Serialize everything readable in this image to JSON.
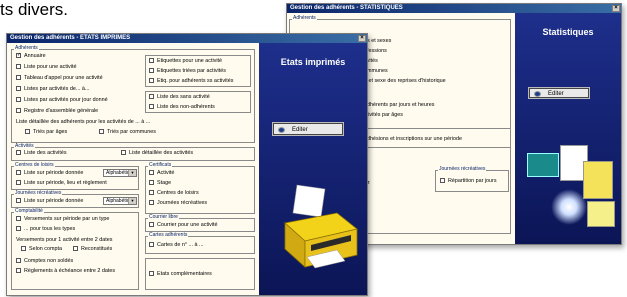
{
  "caption": "ts divers.",
  "stats_window": {
    "title": "Gestion des adhérents - STATISTIQUES",
    "group_label": "Adhérents",
    "rows": [
      "es et sexes",
      "ofessions",
      "tivités",
      "ommunes",
      "e et sexe des reprises d'historique",
      "adhérents par jours et heures",
      "ctivités par âges",
      "adhésions et inscriptions sur une période",
      "ez",
      "r"
    ],
    "journees_label": "Journées récréatives",
    "repetition_label": "Répartition par jours",
    "heading": "Statistiques",
    "edit_button": "Editer"
  },
  "main_window": {
    "title": "Gestion des adhérents - ETATS IMPRIMES",
    "heading": "Etats imprimés",
    "edit_button": "Editer",
    "adherents": {
      "label": "Adhérents",
      "left": [
        "Annuaire",
        "Liste pour une activité",
        "Tableau d'appel pour une activité",
        "Listes par activités de... à...",
        "Listes par activités pour jour donné",
        "Registre d'assemblée générale"
      ],
      "right": [
        "Etiquettes pour une activité",
        "Etiquettes triées par activités",
        "Etiq. pour adhérents ss activités"
      ],
      "right2": [
        "Liste des sans activité",
        "Liste des non-adhérents"
      ],
      "detail_text": "Liste détaillée des adhérents pour les activités de ... à ...",
      "sort1": "Triés par âges",
      "sort2": "Triés par communes"
    },
    "activites": {
      "label": "Activités",
      "left": "Liste des activités",
      "right": "Liste détaillée des activités"
    },
    "centres": {
      "label": "Centres de loisirs",
      "rows": [
        "Liste sur période donnée",
        "Liste sur période, lieu et règlement"
      ],
      "select": "Alphabétique"
    },
    "journees": {
      "label": "Journées récréatives",
      "row": "Liste sur période donnée",
      "select": "Alphabétique"
    },
    "certificats": {
      "label": "Certificats",
      "rows": [
        "Activité",
        "Stage",
        "Centres de loisirs",
        "Journées récréatives"
      ]
    },
    "comptabilite": {
      "label": "Comptabilité",
      "rows": [
        "Versements sur période par un type",
        "... pour tous les types"
      ],
      "vers_text": "Versements pour 1 activité entre 2 dates",
      "opt1": "Selon compta",
      "opt2": "Reconstitués",
      "rows2": [
        "Comptes non soldés",
        "Règlements à échéance entre 2 dates"
      ]
    },
    "courrier": {
      "label": "Courrier libre",
      "row": "Courrier pour une activité"
    },
    "cartes": {
      "label": "Cartes adhérents",
      "row": "Cartes de n° ... à ..."
    },
    "etats_comp": "Etats complémentaires"
  },
  "colors": {
    "title_bar": "#0a246a",
    "panel_blue": "#15206e",
    "form_bg": "#fffcef"
  }
}
